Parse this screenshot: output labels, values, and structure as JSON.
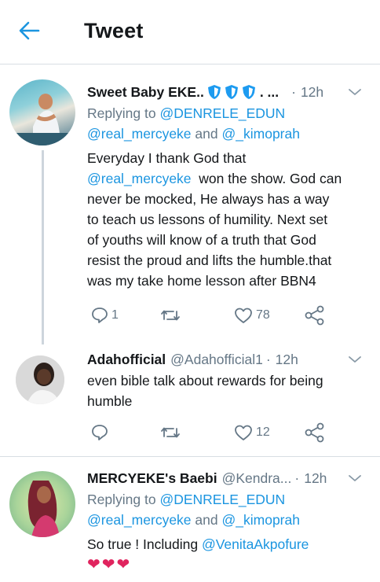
{
  "header": {
    "title": "Tweet"
  },
  "tweets": [
    {
      "name": "Sweet Baby EKE..",
      "handle_trunc": ". ...",
      "separator": "·",
      "time": "12h",
      "replying_prefix": "Replying to",
      "replying_to": "@DENRELE_EDUN",
      "mention_1": "@real_mercyeke",
      "and_text": "and",
      "mention_2": "@_kimoprah",
      "line_1": "Everyday I thank God that",
      "line_2_mention": "@real_mercyeke",
      "line_2_rest": "won the show. God can",
      "line_3": "never be mocked, He always has a way",
      "line_4": "to teach us lessons of humility. Next set",
      "line_5": "of youths will know of a truth that God",
      "line_6": "resist the proud and lifts the humble.that",
      "line_7": "was my take home lesson after BBN4",
      "replies": "1",
      "retweets": "",
      "likes": "78"
    },
    {
      "name": "Adahofficial",
      "handle": "@Adahofficial1",
      "separator": "·",
      "time": "12h",
      "line_1": "even bible talk about rewards for being",
      "line_2": "humble",
      "replies": "",
      "retweets": "",
      "likes": "12"
    },
    {
      "name": "MERCYEKE's Baebi",
      "handle": "@Kendra...",
      "separator": "·",
      "time": "12h",
      "replying_prefix": "Replying to",
      "replying_to": "@DENRELE_EDUN",
      "mention_1": "@real_mercyeke",
      "and_text": "and",
      "mention_2": "@_kimoprah",
      "line_1": "So true ! Including",
      "line_1_mention": "@VenitaAkpofure",
      "hearts": "❤❤❤"
    }
  ],
  "colors": {
    "accent": "#1b95e0",
    "secondary_text": "#657786",
    "badge_blue": "#1d9bf0",
    "heart_pink": "#e0245e"
  }
}
